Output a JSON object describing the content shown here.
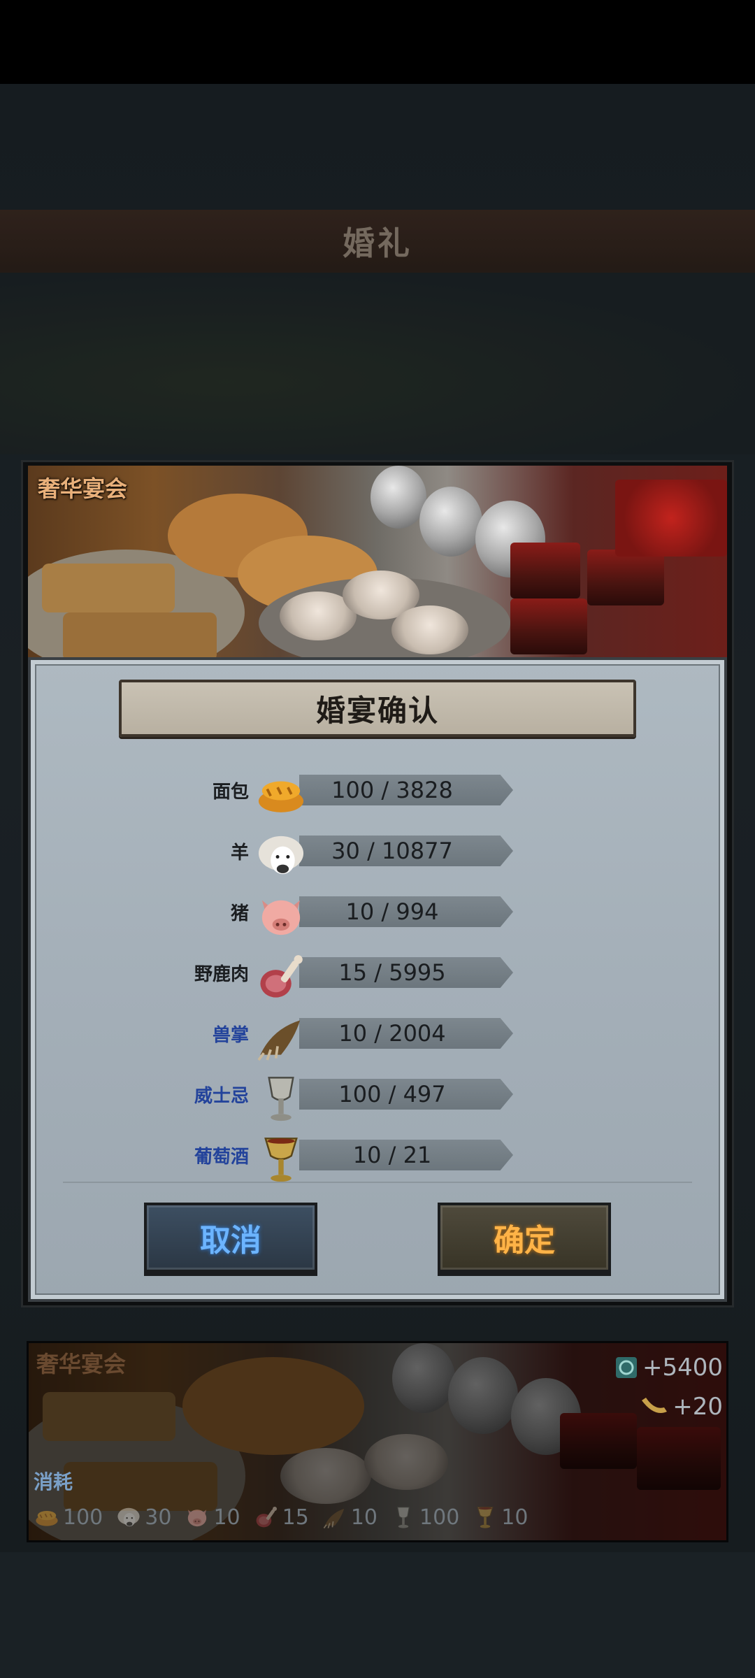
{
  "page": {
    "title": "婚礼"
  },
  "banner": {
    "label": "奢华宴会"
  },
  "dialog": {
    "title": "婚宴确认",
    "items": [
      {
        "label": "面包",
        "amount": "100 / 3828",
        "icon": "bread-icon",
        "label_color": "dark"
      },
      {
        "label": "羊",
        "amount": "30 / 10877",
        "icon": "sheep-icon",
        "label_color": "dark"
      },
      {
        "label": "猪",
        "amount": "10 / 994",
        "icon": "pig-icon",
        "label_color": "dark"
      },
      {
        "label": "野鹿肉",
        "amount": "15 / 5995",
        "icon": "venison-icon",
        "label_color": "dark"
      },
      {
        "label": "兽掌",
        "amount": "10 / 2004",
        "icon": "paw-icon",
        "label_color": "blue"
      },
      {
        "label": "威士忌",
        "amount": "100 / 497",
        "icon": "whisky-goblet-icon",
        "label_color": "blue"
      },
      {
        "label": "葡萄酒",
        "amount": "10 / 21",
        "icon": "wine-goblet-icon",
        "label_color": "blue"
      }
    ],
    "cancel_label": "取消",
    "confirm_label": "确定"
  },
  "bottom_card": {
    "title": "奢华宴会",
    "reward_1": "+5400",
    "reward_2": "+20",
    "consume_label": "消耗",
    "costs": [
      {
        "icon": "bread-icon",
        "value": "100"
      },
      {
        "icon": "sheep-icon",
        "value": "30"
      },
      {
        "icon": "pig-icon",
        "value": "10"
      },
      {
        "icon": "venison-icon",
        "value": "15"
      },
      {
        "icon": "paw-icon",
        "value": "10"
      },
      {
        "icon": "whisky-goblet-icon",
        "value": "100"
      },
      {
        "icon": "wine-goblet-icon",
        "value": "10"
      }
    ]
  },
  "colors": {
    "cancel_text": "#6cb4ff",
    "confirm_text": "#ffb347",
    "banner_label": "#e9b07a",
    "blue_label": "#23439b"
  }
}
